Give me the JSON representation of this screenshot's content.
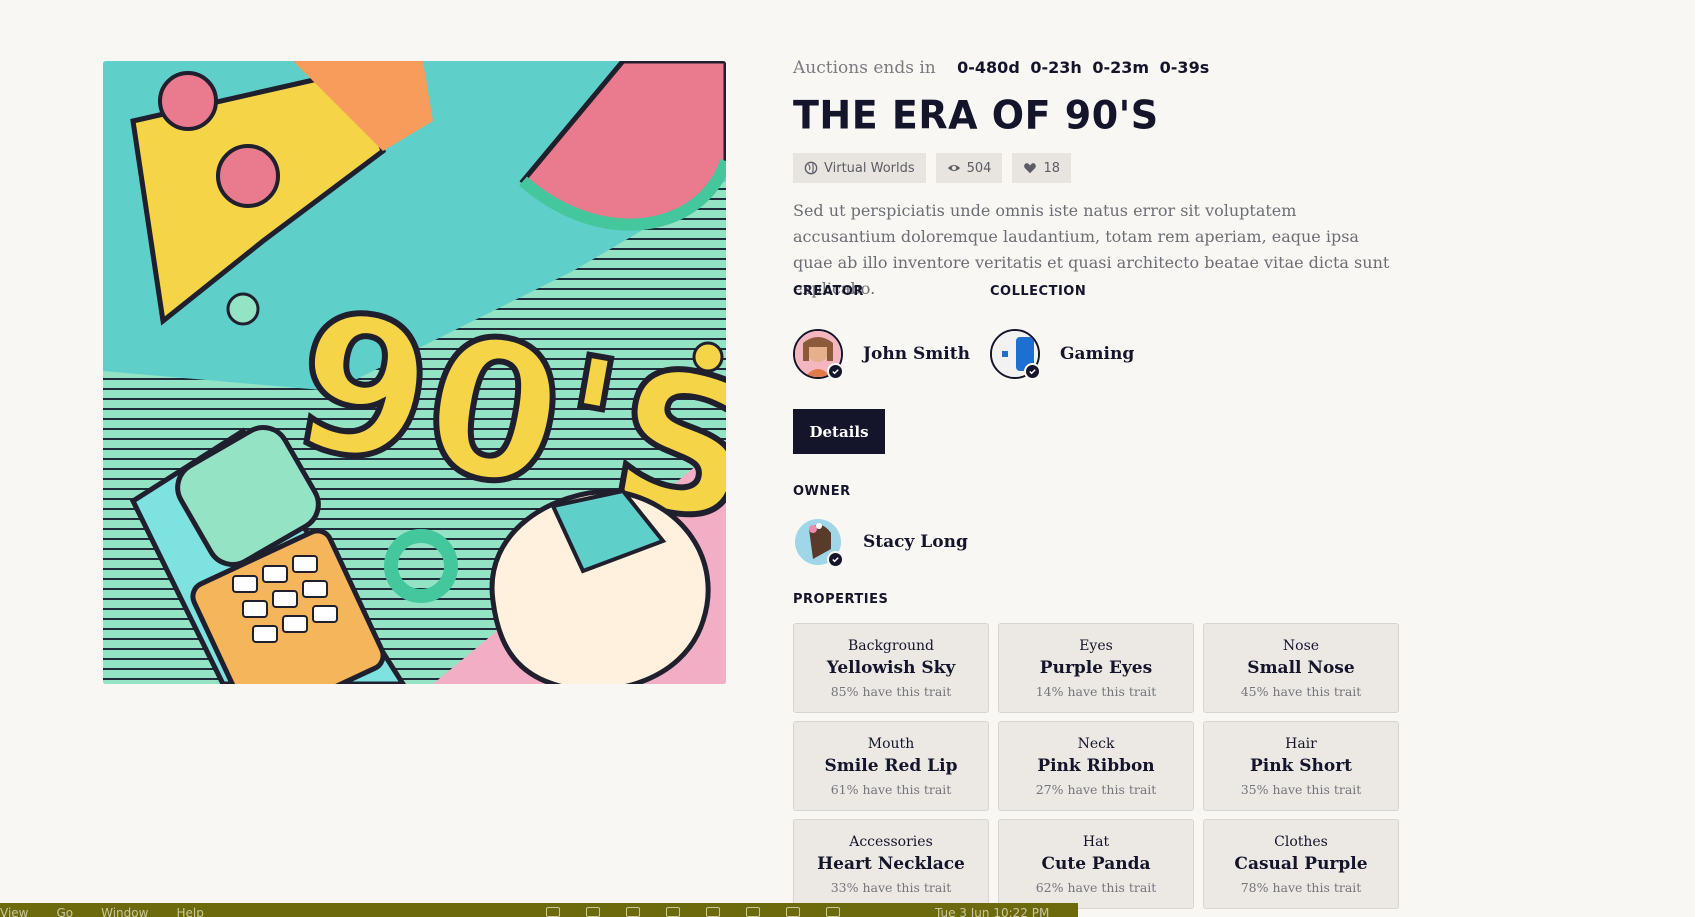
{
  "auction": {
    "label": "Auctions ends in",
    "days": "0-480d",
    "hours": "0-23h",
    "minutes": "0-23m",
    "seconds": "0-39s"
  },
  "title": "THE ERA OF 90'S",
  "artwork": {
    "text": "90'S"
  },
  "tags": [
    {
      "icon": "globe-icon",
      "label": "Virtual Worlds"
    },
    {
      "icon": "eye-icon",
      "label": "504"
    },
    {
      "icon": "heart-icon",
      "label": "18"
    }
  ],
  "description": "Sed ut perspiciatis unde omnis iste natus error sit voluptatem accusantium doloremque laudantium, totam rem aperiam, eaque ipsa quae ab illo inventore veritatis et quasi architecto beatae vitae dicta sunt explicabo.",
  "creator": {
    "label": "CREATOR",
    "name": "John Smith"
  },
  "collection": {
    "label": "COLLECTION",
    "name": "Gaming"
  },
  "details_button": "Details",
  "owner": {
    "label": "OWNER",
    "name": "Stacy Long"
  },
  "properties": {
    "label": "PROPERTIES",
    "items": [
      {
        "trait": "Background",
        "value": "Yellowish Sky",
        "rarity": "85% have this trait"
      },
      {
        "trait": "Eyes",
        "value": "Purple Eyes",
        "rarity": "14% have this trait"
      },
      {
        "trait": "Nose",
        "value": "Small Nose",
        "rarity": "45% have this trait"
      },
      {
        "trait": "Mouth",
        "value": "Smile Red Lip",
        "rarity": "61% have this trait"
      },
      {
        "trait": "Neck",
        "value": "Pink Ribbon",
        "rarity": "27% have this trait"
      },
      {
        "trait": "Hair",
        "value": "Pink Short",
        "rarity": "35% have this trait"
      },
      {
        "trait": "Accessories",
        "value": "Heart Necklace",
        "rarity": "33% have this trait"
      },
      {
        "trait": "Hat",
        "value": "Cute Panda",
        "rarity": "62% have this trait"
      },
      {
        "trait": "Clothes",
        "value": "Casual Purple",
        "rarity": "78% have this trait"
      }
    ]
  },
  "menubar": {
    "items": [
      "View",
      "Go",
      "Window",
      "Help"
    ],
    "datetime": "Tue 3 Jun  10:22 PM"
  },
  "colors": {
    "background": "#f9f7f3",
    "dark": "#14142b",
    "menubar": "#6d6a0e"
  }
}
